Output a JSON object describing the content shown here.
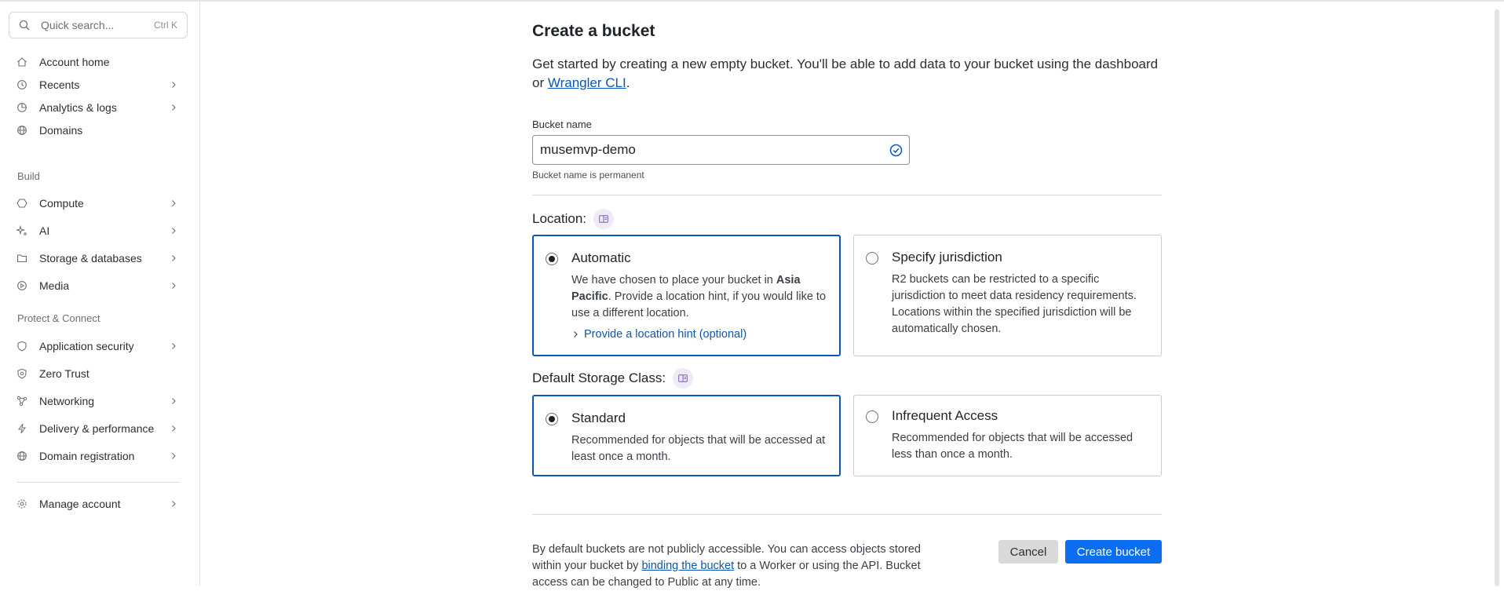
{
  "search": {
    "placeholder": "Quick search...",
    "shortcut": "Ctrl K"
  },
  "sidebar": {
    "items": [
      {
        "label": "Account home",
        "icon": "home-icon",
        "has_chevron": false
      },
      {
        "label": "Recents",
        "icon": "history-icon",
        "has_chevron": true
      },
      {
        "label": "Analytics & logs",
        "icon": "chart-pie-icon",
        "has_chevron": true
      },
      {
        "label": "Domains",
        "icon": "globe-icon",
        "has_chevron": false
      }
    ],
    "build_label": "Build",
    "build_items": [
      {
        "label": "Compute",
        "icon": "compute-icon",
        "has_chevron": true
      },
      {
        "label": "AI",
        "icon": "sparkle-icon",
        "has_chevron": true
      },
      {
        "label": "Storage & databases",
        "icon": "storage-icon",
        "has_chevron": true
      },
      {
        "label": "Media",
        "icon": "media-icon",
        "has_chevron": true
      }
    ],
    "protect_label": "Protect & Connect",
    "protect_items": [
      {
        "label": "Application security",
        "icon": "shield-icon",
        "has_chevron": true
      },
      {
        "label": "Zero Trust",
        "icon": "zero-trust-icon",
        "has_chevron": false
      },
      {
        "label": "Networking",
        "icon": "network-icon",
        "has_chevron": true
      },
      {
        "label": "Delivery & performance",
        "icon": "bolt-icon",
        "has_chevron": true
      },
      {
        "label": "Domain registration",
        "icon": "globe-icon",
        "has_chevron": true
      }
    ],
    "manage": {
      "label": "Manage account",
      "icon": "gear-icon",
      "has_chevron": true
    }
  },
  "main": {
    "title": "Create a bucket",
    "intro_text": "Get started by creating a new empty bucket. You'll be able to add data to your bucket using the dashboard or ",
    "intro_link": "Wrangler CLI",
    "intro_end": ".",
    "bucket_name_label": "Bucket name",
    "bucket_name_value": "musemvp-demo",
    "bucket_name_hint": "Bucket name is permanent",
    "location_label": "Location:",
    "location_options": {
      "automatic": {
        "title": "Automatic",
        "desc_before": "We have chosen to place your bucket in ",
        "desc_bold": "Asia Pacific",
        "desc_after": ". Provide a location hint, if you would like to use a different location.",
        "expander": "Provide a location hint (optional)",
        "selected": true
      },
      "jurisdiction": {
        "title": "Specify jurisdiction",
        "desc": "R2 buckets can be restricted to a specific jurisdiction to meet data residency requirements. Locations within the specified jurisdiction will be automatically chosen.",
        "selected": false
      }
    },
    "storage_class_label": "Default Storage Class:",
    "storage_options": {
      "standard": {
        "title": "Standard",
        "desc": "Recommended for objects that will be accessed at least once a month.",
        "selected": true
      },
      "infrequent": {
        "title": "Infrequent Access",
        "desc": "Recommended for objects that will be accessed less than once a month.",
        "selected": false
      }
    },
    "footer_before": "By default buckets are not publicly accessible. You can access objects stored within your bucket by ",
    "footer_link": "binding the bucket",
    "footer_after": " to a Worker or using the API. Bucket access can be changed to Public at any time.",
    "cancel_label": "Cancel",
    "create_label": "Create bucket"
  },
  "colors": {
    "accent": "#0b57b7",
    "primary_button": "#0b6df0",
    "cancel_button": "#d9d9d9"
  }
}
